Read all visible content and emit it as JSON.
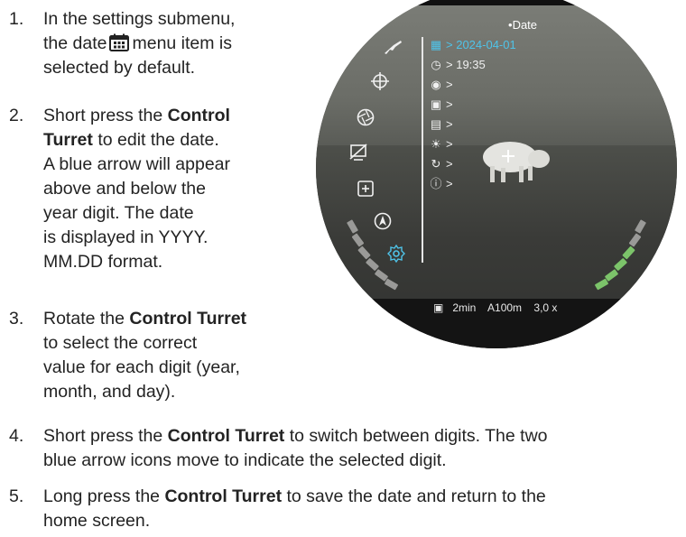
{
  "steps": [
    {
      "num": "1.",
      "parts": [
        "In the settings submenu,",
        "the date",
        "menu item is",
        "selected by default."
      ]
    },
    {
      "num": "2.",
      "lines": [
        "Short press the",
        "Control",
        "Turret",
        " to edit the date.",
        "A blue arrow will appear",
        "above and below the",
        "year digit. The date",
        "is displayed in YYYY.",
        "MM.DD format."
      ]
    },
    {
      "num": "3.",
      "lines": [
        "Rotate the",
        "Control Turret",
        "to select the correct",
        "value for each digit (year,",
        "month, and day)."
      ]
    },
    {
      "num": "4.",
      "lines": [
        "Short press the",
        "Control Turret",
        " to switch between digits. The two",
        "blue arrow icons move to indicate the selected digit."
      ]
    },
    {
      "num": "5.",
      "lines": [
        "Long press the",
        "Control Turret",
        " to save the date and return to the",
        "home screen."
      ]
    }
  ],
  "scope": {
    "menu_header": "Date",
    "date_value": "2024-04-01",
    "time_value": "19:35",
    "bottom_bar": {
      "timer": "2min",
      "range": "A100m",
      "zoom": "3,0 x"
    },
    "accent_color": "#4fc3e8",
    "left_icons": [
      "rifle-icon",
      "crosshair-icon",
      "aperture-icon",
      "display-off-icon",
      "zoom-box-icon",
      "compass-icon",
      "settings-gear-icon"
    ],
    "menu_rows": [
      {
        "icon": "calendar-icon",
        "value": "2024-04-01",
        "active": true
      },
      {
        "icon": "clock-icon",
        "value": "19:35",
        "active": false
      },
      {
        "icon": "globe-icon",
        "value": "",
        "active": false
      },
      {
        "icon": "image-calibration-icon",
        "value": "",
        "active": false
      },
      {
        "icon": "display-settings-icon",
        "value": "",
        "active": false
      },
      {
        "icon": "brightness-icon",
        "value": "",
        "active": false
      },
      {
        "icon": "reset-icon",
        "value": "",
        "active": false
      },
      {
        "icon": "info-icon",
        "value": "",
        "active": false
      }
    ]
  }
}
